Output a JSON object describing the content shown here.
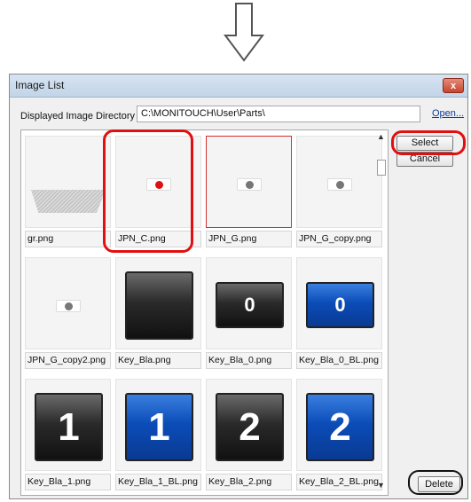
{
  "dialog": {
    "title": "Image List",
    "close_label": "x",
    "directory_label": "Displayed Image Directory",
    "directory_value": "C:\\MONITOUCH\\User\\Parts\\",
    "open_label": "Open..."
  },
  "buttons": {
    "select": "Select",
    "cancel": "Cancel",
    "delete": "Delete"
  },
  "images": [
    {
      "name": "gr.png",
      "kind": "gradient-bar"
    },
    {
      "name": "JPN_C.png",
      "kind": "dot",
      "dot_color": "#e01010"
    },
    {
      "name": "JPN_G.png",
      "kind": "dot",
      "dot_color": "#777777",
      "selected": true
    },
    {
      "name": "JPN_G_copy.png",
      "kind": "dot",
      "dot_color": "#777777"
    },
    {
      "name": "JPN_G_copy2.png",
      "kind": "dot",
      "dot_color": "#777777"
    },
    {
      "name": "Key_Bla.png",
      "kind": "black-key"
    },
    {
      "name": "Key_Bla_0.png",
      "kind": "key",
      "color": "black",
      "digit": "0"
    },
    {
      "name": "Key_Bla_0_BL.png",
      "kind": "key",
      "color": "blue",
      "digit": "0"
    },
    {
      "name": "Key_Bla_1.png",
      "kind": "key",
      "color": "black",
      "digit": "1"
    },
    {
      "name": "Key_Bla_1_BL.png",
      "kind": "key",
      "color": "blue",
      "digit": "1"
    },
    {
      "name": "Key_Bla_2.png",
      "kind": "key",
      "color": "black",
      "digit": "2"
    },
    {
      "name": "Key_Bla_2_BL.png",
      "kind": "key",
      "color": "blue",
      "digit": "2"
    }
  ],
  "colors": {
    "highlight_ring": "#e01010",
    "selected_border": "#d32f2f",
    "key_blue": "#0b4cb8",
    "key_black": "#222222"
  }
}
